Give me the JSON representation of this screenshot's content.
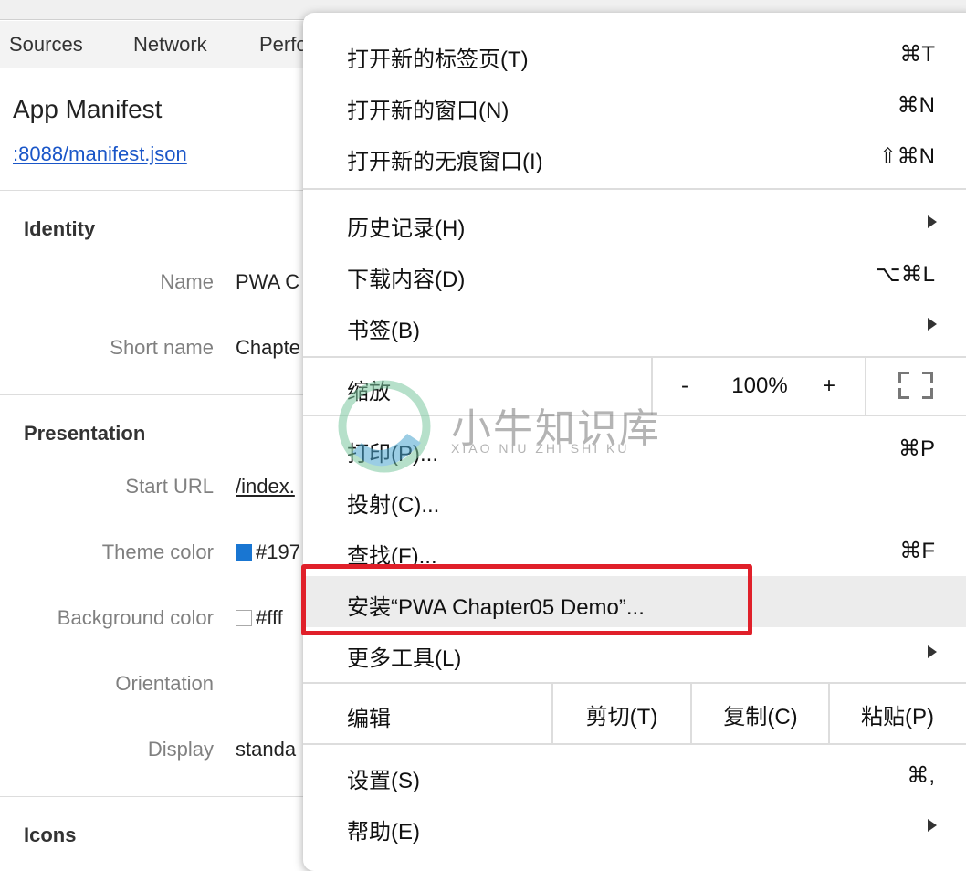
{
  "devtools": {
    "tabs": [
      "Sources",
      "Network",
      "Perfo"
    ],
    "title": "App Manifest",
    "manifest_url": ":8088/manifest.json",
    "sections": {
      "identity": {
        "heading": "Identity",
        "rows": [
          {
            "label": "Name",
            "value": "PWA C"
          },
          {
            "label": "Short name",
            "value": "Chapte"
          }
        ]
      },
      "presentation": {
        "heading": "Presentation",
        "rows": [
          {
            "label": "Start URL",
            "value": "/index."
          },
          {
            "label": "Theme color",
            "value": "#197",
            "swatch": "#1976d2"
          },
          {
            "label": "Background color",
            "value": "#fff",
            "swatch": "#ffffff"
          },
          {
            "label": "Orientation",
            "value": ""
          },
          {
            "label": "Display",
            "value": "standa"
          }
        ]
      },
      "icons": {
        "heading": "Icons"
      }
    }
  },
  "menu": {
    "new_tab": {
      "label": "打开新的标签页(T)",
      "shortcut": "⌘T"
    },
    "new_window": {
      "label": "打开新的窗口(N)",
      "shortcut": "⌘N"
    },
    "new_incognito": {
      "label": "打开新的无痕窗口(I)",
      "shortcut": "⇧⌘N"
    },
    "history": {
      "label": "历史记录(H)"
    },
    "downloads": {
      "label": "下载内容(D)",
      "shortcut": "⌥⌘L"
    },
    "bookmarks": {
      "label": "书签(B)"
    },
    "zoom": {
      "label": "缩放",
      "minus": "-",
      "value": "100%",
      "plus": "+"
    },
    "print": {
      "label": "打印(P)...",
      "shortcut": "⌘P"
    },
    "cast": {
      "label": "投射(C)..."
    },
    "find": {
      "label": "查找(F)...",
      "shortcut": "⌘F"
    },
    "install": {
      "label": "安装“PWA Chapter05 Demo”..."
    },
    "more_tools": {
      "label": "更多工具(L)"
    },
    "edit": {
      "label": "编辑",
      "cut": "剪切(T)",
      "copy": "复制(C)",
      "paste": "粘贴(P)"
    },
    "settings": {
      "label": "设置(S)",
      "shortcut": "⌘,"
    },
    "help": {
      "label": "帮助(E)"
    }
  },
  "highlight_color": "#e0202a",
  "watermark": {
    "cn": "小牛知识库",
    "en": "XIAO NIU ZHI SHI KU"
  }
}
